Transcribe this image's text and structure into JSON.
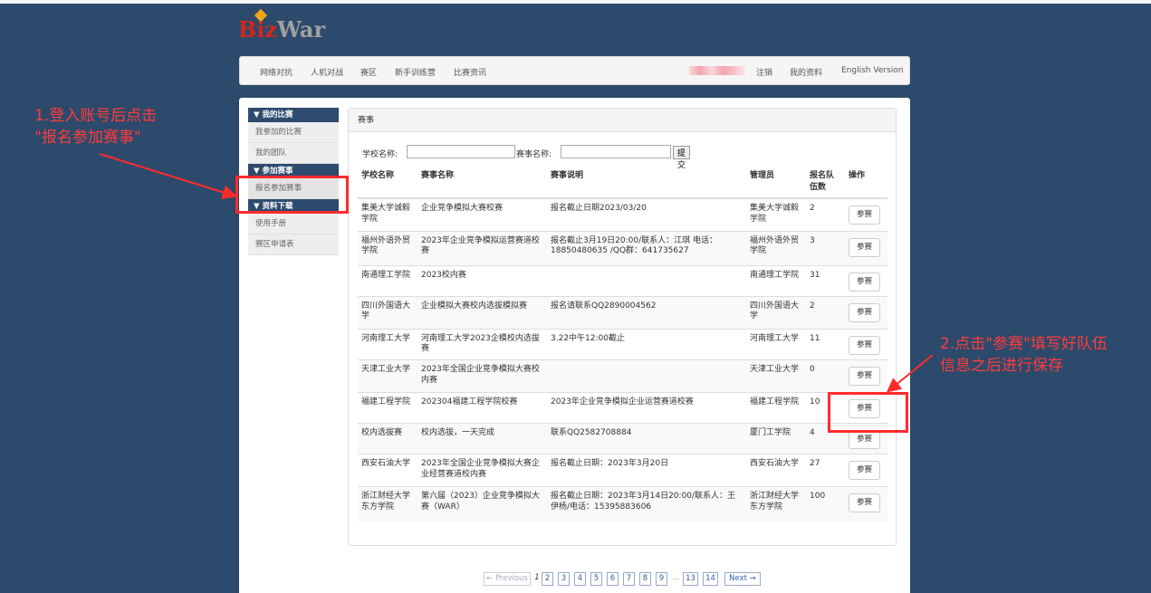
{
  "logo": {
    "part1": "Biz",
    "part2": "War"
  },
  "nav": {
    "items": [
      "网络对抗",
      "人机对战",
      "赛区",
      "新手训练营",
      "比赛资讯"
    ],
    "right": [
      "注销",
      "我的资料",
      "English Version"
    ]
  },
  "sidebar": {
    "sections": [
      {
        "title": "▼ 我的比赛",
        "items": [
          "我参加的比赛",
          "我的团队"
        ]
      },
      {
        "title": "▼ 参加赛事",
        "items": [
          "报名参加赛事"
        ]
      },
      {
        "title": "▼ 资料下载",
        "items": [
          "使用手册",
          "赛区申请表"
        ]
      }
    ]
  },
  "panel": {
    "title": "赛事"
  },
  "search": {
    "school_label": "学校名称:",
    "event_label": "赛事名称:",
    "submit": "提交"
  },
  "table": {
    "headers": [
      "学校名称",
      "赛事名称",
      "赛事说明",
      "管理员",
      "报名队伍数",
      "操作"
    ],
    "join_label": "参赛",
    "rows": [
      [
        "集美大学诚毅学院",
        "企业竞争模拟大赛校赛",
        "报名截止日期2023/03/20",
        "集美大学诚毅学院",
        "2"
      ],
      [
        "福州外语外贸学院",
        "2023年企业竞争模拟运营赛道校赛",
        "报名截止3月19日20:00/联系人：江琪 电话：18850480635 /QQ群：641735627",
        "福州外语外贸学院",
        "3"
      ],
      [
        "南通理工学院",
        "2023校内赛",
        "",
        "南通理工学院",
        "31"
      ],
      [
        "四川外国语大学",
        "企业模拟大赛校内选拔模拟赛",
        "报名请联系QQ2890004562",
        "四川外国语大学",
        "2"
      ],
      [
        "河南理工大学",
        "河南理工大学2023企模校内选拔赛",
        "3.22中午12:00截止",
        "河南理工大学",
        "11"
      ],
      [
        "天津工业大学",
        "2023年全国企业竞争模拟大赛校内赛",
        "",
        "天津工业大学",
        "0"
      ],
      [
        "福建工程学院",
        "202304福建工程学院校赛",
        "2023年企业竞争模拟企业运营赛道校赛",
        "福建工程学院",
        "10"
      ],
      [
        "校内选拔赛",
        "校内选拔，一天完成",
        "联系QQ2582708884",
        "厦门工学院",
        "4"
      ],
      [
        "西安石油大学",
        "2023年全国企业竞争模拟大赛企业经营赛道校内赛",
        "报名截止日期：2023年3月20日",
        "西安石油大学",
        "27"
      ],
      [
        "浙江财经大学东方学院",
        "第六届（2023）企业竞争模拟大赛（WAR）",
        "报名截止日期：2023年3月14日20:00/联系人：王伊杨/电话：15395883606",
        "浙江财经大学东方学院",
        "100"
      ]
    ]
  },
  "pagination": {
    "prev": "← Previous",
    "current": "1",
    "pages": [
      "2",
      "3",
      "4",
      "5",
      "6",
      "7",
      "8",
      "9"
    ],
    "dots": "...",
    "tail": [
      "13",
      "14"
    ],
    "next": "Next →"
  },
  "annotations": {
    "note1_line1": "1.登入账号后点击",
    "note1_line2": "\"报名参加赛事\"",
    "note2_line1": "2.点击\"参赛\"填写好队伍",
    "note2_line2": "信息之后进行保存",
    "color": "#ff2b2b"
  }
}
